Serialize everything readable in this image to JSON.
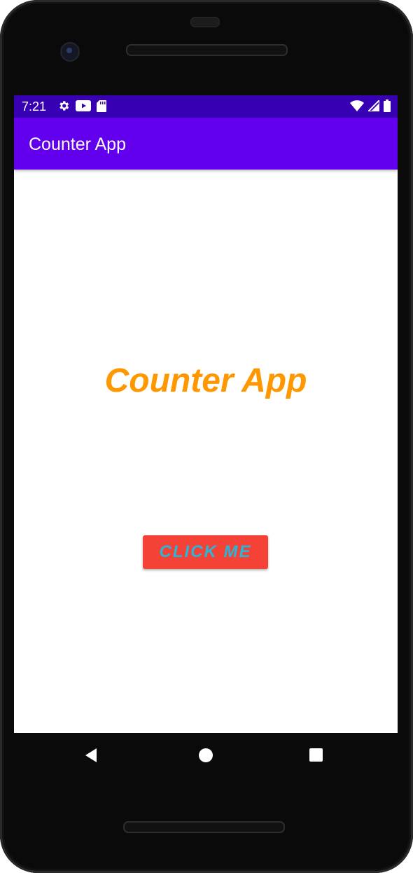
{
  "status_bar": {
    "time": "7:21",
    "left_icons": [
      "gear-icon",
      "youtube-icon",
      "sd-card-icon"
    ],
    "right_icons": [
      "wifi-icon",
      "signal-icon",
      "battery-icon"
    ]
  },
  "app_bar": {
    "title": "Counter App"
  },
  "main": {
    "heading": "Counter App",
    "button_label": "CLICK ME"
  },
  "nav_bar": {
    "buttons": [
      "back",
      "home",
      "recents"
    ]
  },
  "colors": {
    "status_bar": "#3700b3",
    "app_bar": "#6200ee",
    "heading": "#ff9800",
    "button_bg": "#f44336",
    "button_text": "#29b6d8"
  }
}
